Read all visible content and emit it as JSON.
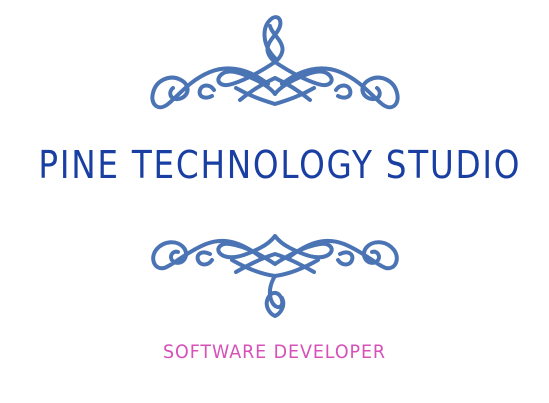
{
  "logo": {
    "title": "PINE TECHNOLOGY STUDIO",
    "subtitle": "SOFTWARE DEVELOPER",
    "ornament_top_icon": "flourish-ornament-icon",
    "ornament_bottom_icon": "flourish-ornament-icon"
  },
  "colors": {
    "title": "#1a3fa3",
    "subtitle": "#d651b8",
    "ornament": "#4b74b5",
    "background": "#ffffff"
  }
}
